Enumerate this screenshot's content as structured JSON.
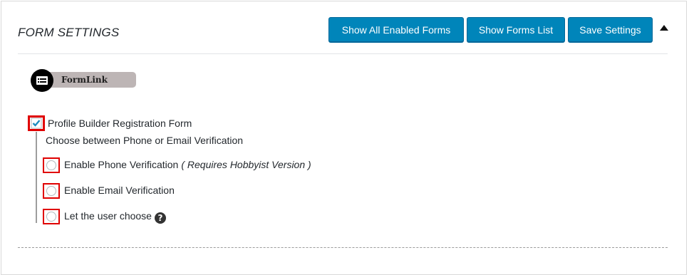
{
  "panel": {
    "title": "FORM SETTINGS",
    "buttons": {
      "show_all": "Show All Enabled Forms",
      "show_list": "Show Forms List",
      "save": "Save Settings"
    },
    "collapse_icon": "triangle-up-icon"
  },
  "plugin_badge": {
    "icon": "form-card-icon",
    "label": "FormLink"
  },
  "form": {
    "checked": true,
    "label": "Profile Builder Registration Form",
    "sub_label": "Choose between Phone or Email Verification",
    "options": [
      {
        "label": "Enable Phone Verification",
        "note": "( Requires Hobbyist Version )",
        "selected": false
      },
      {
        "label": "Enable Email Verification",
        "selected": false
      },
      {
        "label": "Let the user choose",
        "help_icon": "question-mark-icon",
        "help_glyph": "?",
        "selected": false
      }
    ]
  },
  "colors": {
    "button_bg": "#0085ba",
    "highlight_border": "#e00000",
    "badge_bg": "#bdb5b5"
  }
}
